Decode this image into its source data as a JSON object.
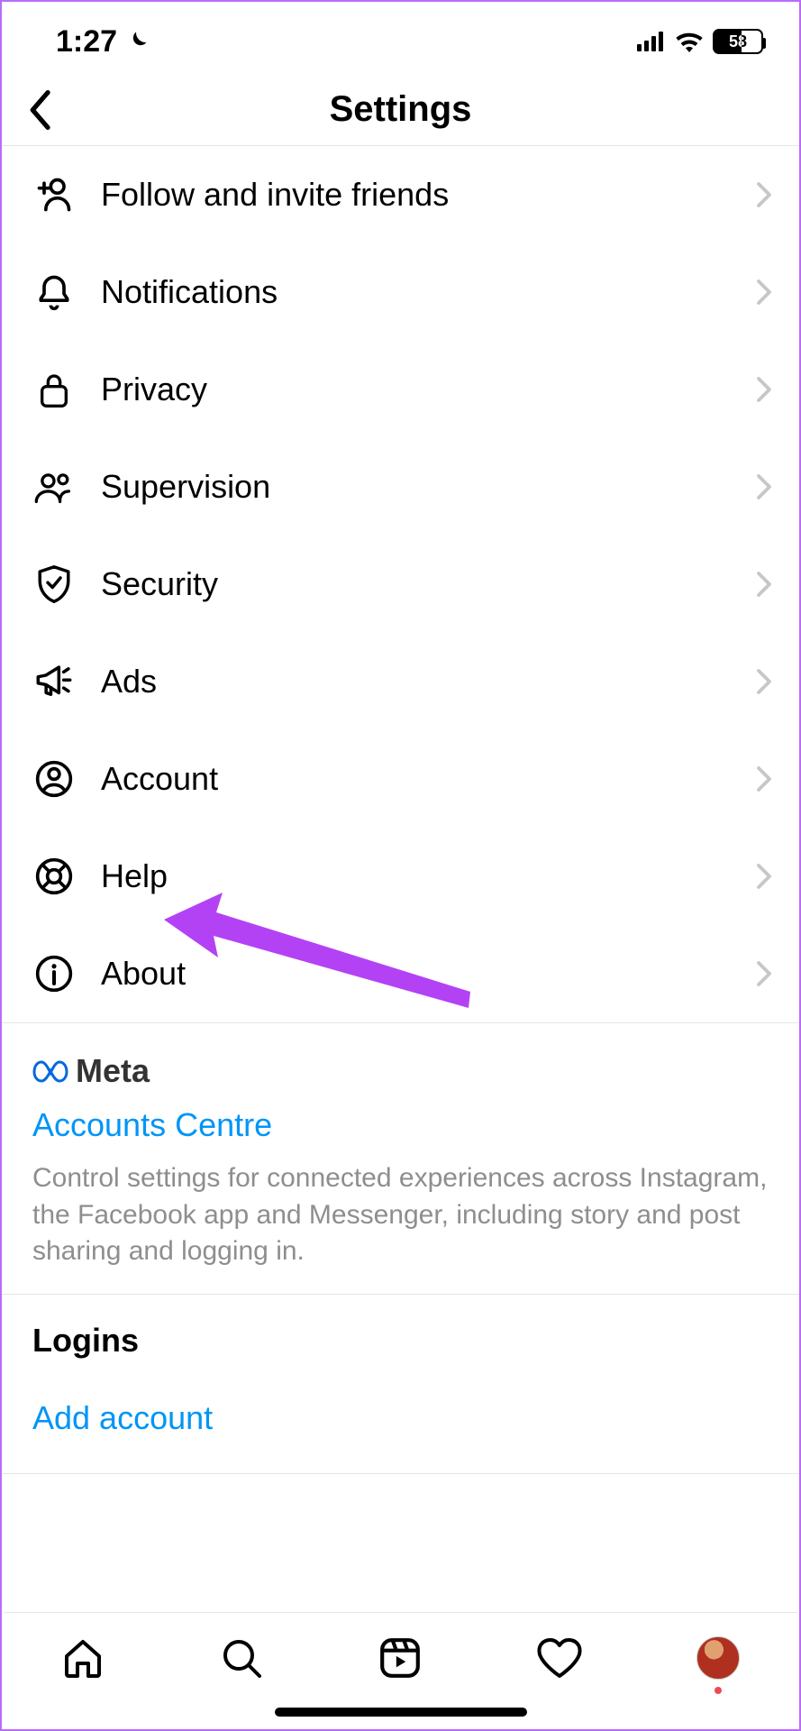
{
  "status": {
    "time": "1:27",
    "battery": "58"
  },
  "header": {
    "title": "Settings"
  },
  "settings": [
    {
      "key": "invite",
      "label": "Follow and invite friends",
      "icon": "person-plus-icon"
    },
    {
      "key": "notifications",
      "label": "Notifications",
      "icon": "bell-icon"
    },
    {
      "key": "privacy",
      "label": "Privacy",
      "icon": "lock-icon"
    },
    {
      "key": "supervision",
      "label": "Supervision",
      "icon": "people-icon"
    },
    {
      "key": "security",
      "label": "Security",
      "icon": "shield-check-icon"
    },
    {
      "key": "ads",
      "label": "Ads",
      "icon": "megaphone-icon"
    },
    {
      "key": "account",
      "label": "Account",
      "icon": "person-circle-icon"
    },
    {
      "key": "help",
      "label": "Help",
      "icon": "lifebuoy-icon"
    },
    {
      "key": "about",
      "label": "About",
      "icon": "info-icon"
    }
  ],
  "meta": {
    "brand": "Meta",
    "link": "Accounts Centre",
    "desc": "Control settings for connected experiences across Instagram, the Facebook app and Messenger, including story and post sharing and logging in."
  },
  "logins": {
    "title": "Logins",
    "add": "Add account"
  }
}
